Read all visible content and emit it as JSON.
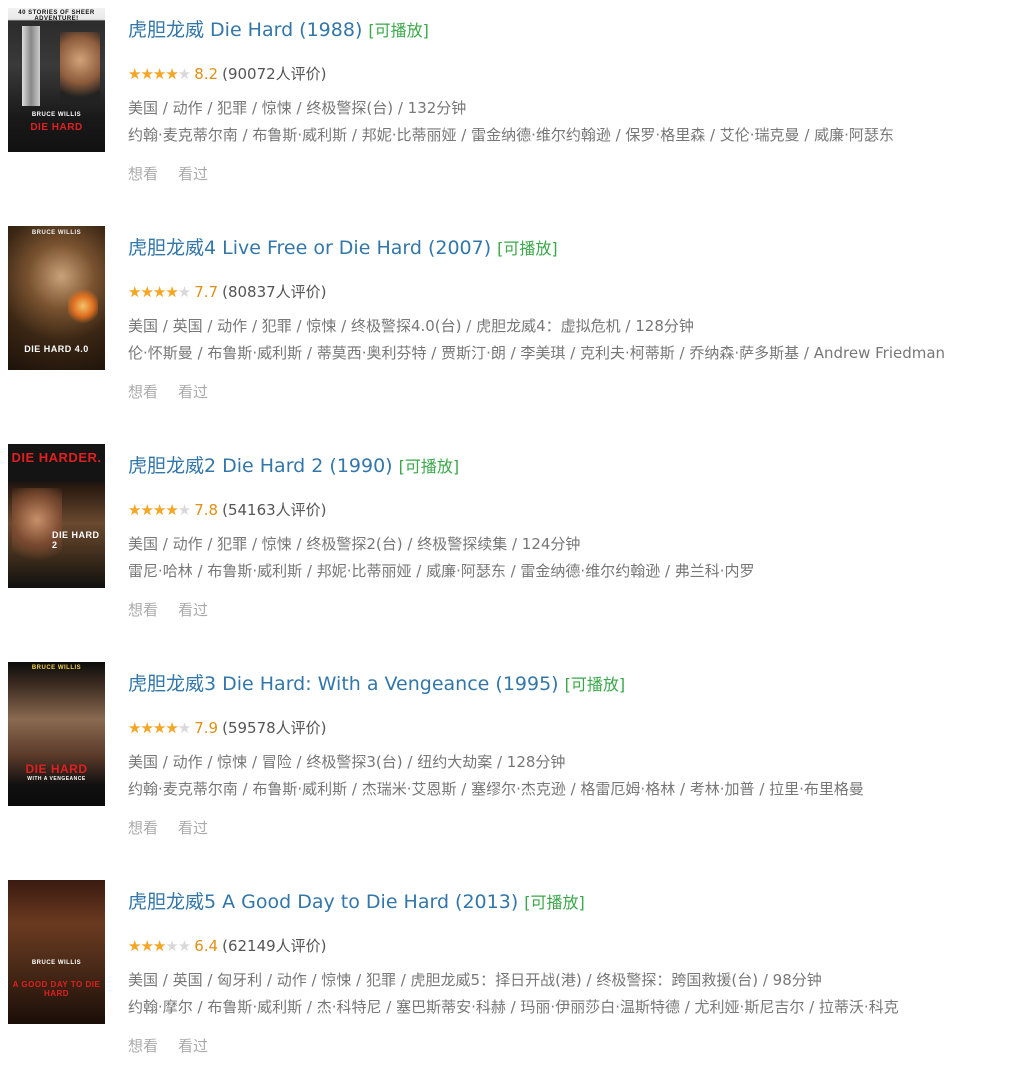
{
  "movies": [
    {
      "title": "虎胆龙威 Die Hard (1988)",
      "playable": "[可播放]",
      "rating": 8.2,
      "score": "8.2",
      "votes": "(90072人评价)",
      "meta": "美国 / 动作 / 犯罪 / 惊悚 / 终极警探(台) / 132分钟",
      "cast": "约翰·麦克蒂尔南 / 布鲁斯·威利斯 / 邦妮·比蒂丽娅 / 雷金纳德·维尔约翰逊 / 保罗·格里森 / 艾伦·瑞克曼 / 威廉·阿瑟东",
      "want": "想看",
      "seen": "看过",
      "poster": {
        "top_text": "40 STORIES OF SHEER ADVENTURE!",
        "bottom_text": "DIE HARD",
        "byline": "BRUCE WILLIS"
      }
    },
    {
      "title": "虎胆龙威4 Live Free or Die Hard (2007)",
      "playable": "[可播放]",
      "rating": 7.7,
      "score": "7.7",
      "votes": "(80837人评价)",
      "meta": "美国 / 英国 / 动作 / 犯罪 / 惊悚 / 终极警探4.0(台) / 虎胆龙威4：虚拟危机 / 128分钟",
      "cast": "伦·怀斯曼 / 布鲁斯·威利斯 / 蒂莫西·奥利芬特 / 贾斯汀·朗 / 李美琪 / 克利夫·柯蒂斯 / 乔纳森·萨多斯基 / Andrew Friedman",
      "want": "想看",
      "seen": "看过",
      "poster": {
        "top_text": "BRUCE WILLIS",
        "bottom_text": "DIE HARD 4.0",
        "byline": ""
      }
    },
    {
      "title": "虎胆龙威2 Die Hard 2 (1990)",
      "playable": "[可播放]",
      "rating": 7.8,
      "score": "7.8",
      "votes": "(54163人评价)",
      "meta": "美国 / 动作 / 犯罪 / 惊悚 / 终极警探2(台) / 终极警探续集 / 124分钟",
      "cast": "雷尼·哈林 / 布鲁斯·威利斯 / 邦妮·比蒂丽娅 / 威廉·阿瑟东 / 雷金纳德·维尔约翰逊 / 弗兰科·内罗",
      "want": "想看",
      "seen": "看过",
      "poster": {
        "top_text": "DIE HARDER.",
        "bottom_text": "DIE HARD 2",
        "byline": ""
      }
    },
    {
      "title": "虎胆龙威3 Die Hard: With a Vengeance (1995)",
      "playable": "[可播放]",
      "rating": 7.9,
      "score": "7.9",
      "votes": "(59578人评价)",
      "meta": "美国 / 动作 / 惊悚 / 冒险 / 终极警探3(台) / 纽约大劫案 / 128分钟",
      "cast": "约翰·麦克蒂尔南 / 布鲁斯·威利斯 / 杰瑞米·艾恩斯 / 塞缪尔·杰克逊 / 格雷厄姆·格林 / 考林·加普 / 拉里·布里格曼",
      "want": "想看",
      "seen": "看过",
      "poster": {
        "top_text": "BRUCE WILLIS",
        "bottom_text": "DIE HARD",
        "byline": "WITH A VENGEANCE"
      }
    },
    {
      "title": "虎胆龙威5 A Good Day to Die Hard (2013)",
      "playable": "[可播放]",
      "rating": 6.4,
      "score": "6.4",
      "votes": "(62149人评价)",
      "meta": "美国 / 英国 / 匈牙利 / 动作 / 惊悚 / 犯罪 / 虎胆龙威5：择日开战(港) / 终极警探：跨国救援(台) / 98分钟",
      "cast": "约翰·摩尔 / 布鲁斯·威利斯 / 杰·科特尼 / 塞巴斯蒂安·科赫 / 玛丽·伊丽莎白·温斯特德 / 尤利娅·斯尼吉尔 / 拉蒂沃·科克",
      "want": "想看",
      "seen": "看过",
      "poster": {
        "top_text": "BRUCE WILLIS",
        "bottom_text": "A GOOD DAY TO DIE HARD",
        "byline": ""
      }
    }
  ],
  "colors": {
    "title": "#3377aa",
    "playable": "#3aa84a",
    "star": "#f5a623",
    "score": "#e09015",
    "meta": "#777777",
    "action": "#aaaaaa"
  },
  "icons": {
    "star": "star-icon"
  }
}
